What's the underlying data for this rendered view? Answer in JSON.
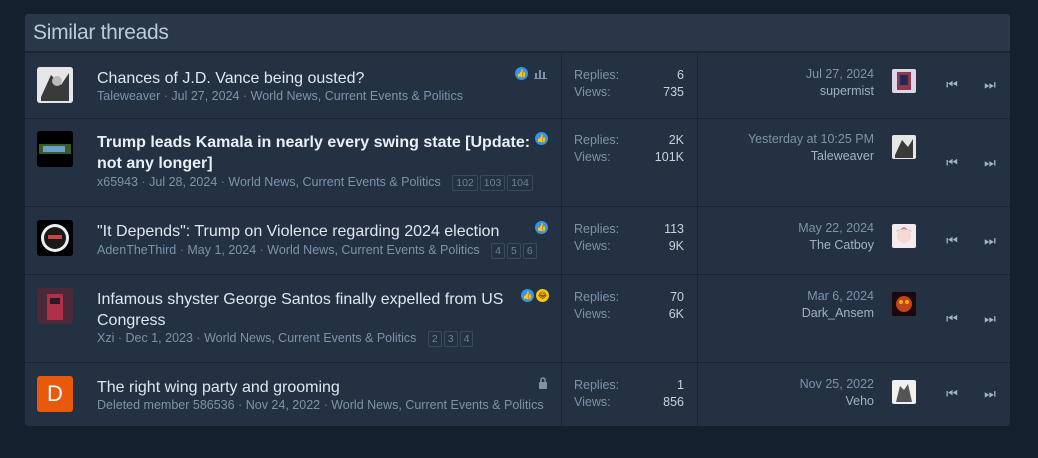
{
  "block": {
    "title": "Similar threads"
  },
  "threads": [
    {
      "title": "Chances of J.D. Vance being ousted?",
      "author": "Taleweaver",
      "date": "Jul 27, 2024",
      "forum": "World News, Current Events & Politics",
      "pages": [],
      "replies_label": "Replies:",
      "replies": "6",
      "views_label": "Views:",
      "views": "735",
      "last_date": "Jul 27, 2024",
      "last_user": "supermist",
      "badges": [
        "like-icon",
        "poll-icon"
      ],
      "avatar_letter": ""
    },
    {
      "title": "Trump leads Kamala in nearly every swing state [Update: not any longer]",
      "author": "x65943",
      "date": "Jul 28, 2024",
      "forum": "World News, Current Events & Politics",
      "pages": [
        "102",
        "103",
        "104"
      ],
      "replies_label": "Replies:",
      "replies": "2K",
      "views_label": "Views:",
      "views": "101K",
      "last_date": "Yesterday at 10:25 PM",
      "last_user": "Taleweaver",
      "badges": [
        "like-icon"
      ],
      "avatar_letter": ""
    },
    {
      "title": "\"It Depends\": Trump on Violence regarding 2024 election",
      "author": "AdenTheThird",
      "date": "May 1, 2024",
      "forum": "World News, Current Events & Politics",
      "pages": [
        "4",
        "5",
        "6"
      ],
      "replies_label": "Replies:",
      "replies": "113",
      "views_label": "Views:",
      "views": "9K",
      "last_date": "May 22, 2024",
      "last_user": "The Catboy",
      "badges": [
        "like-icon"
      ],
      "avatar_letter": ""
    },
    {
      "title": "Infamous shyster George Santos finally expelled from US Congress",
      "author": "Xzi",
      "date": "Dec 1, 2023",
      "forum": "World News, Current Events & Politics",
      "pages": [
        "2",
        "3",
        "4"
      ],
      "replies_label": "Replies:",
      "replies": "70",
      "views_label": "Views:",
      "views": "6K",
      "last_date": "Mar 6, 2024",
      "last_user": "Dark_Ansem",
      "badges": [
        "like-icon",
        "laugh-icon"
      ],
      "avatar_letter": ""
    },
    {
      "title": "The right wing party and grooming",
      "author": "Deleted member 586536",
      "date": "Nov 24, 2022",
      "forum": "World News, Current Events & Politics",
      "pages": [],
      "replies_label": "Replies:",
      "replies": "1",
      "views_label": "Views:",
      "views": "856",
      "last_date": "Nov 25, 2022",
      "last_user": "Veho",
      "badges": [
        "lock-icon"
      ],
      "avatar_letter": "D"
    }
  ],
  "sep": "·",
  "nav": {
    "first": "⏮",
    "last": "⏭"
  },
  "colors": {
    "accent": "#2f97e9",
    "avatar_d": "#e8590c"
  }
}
